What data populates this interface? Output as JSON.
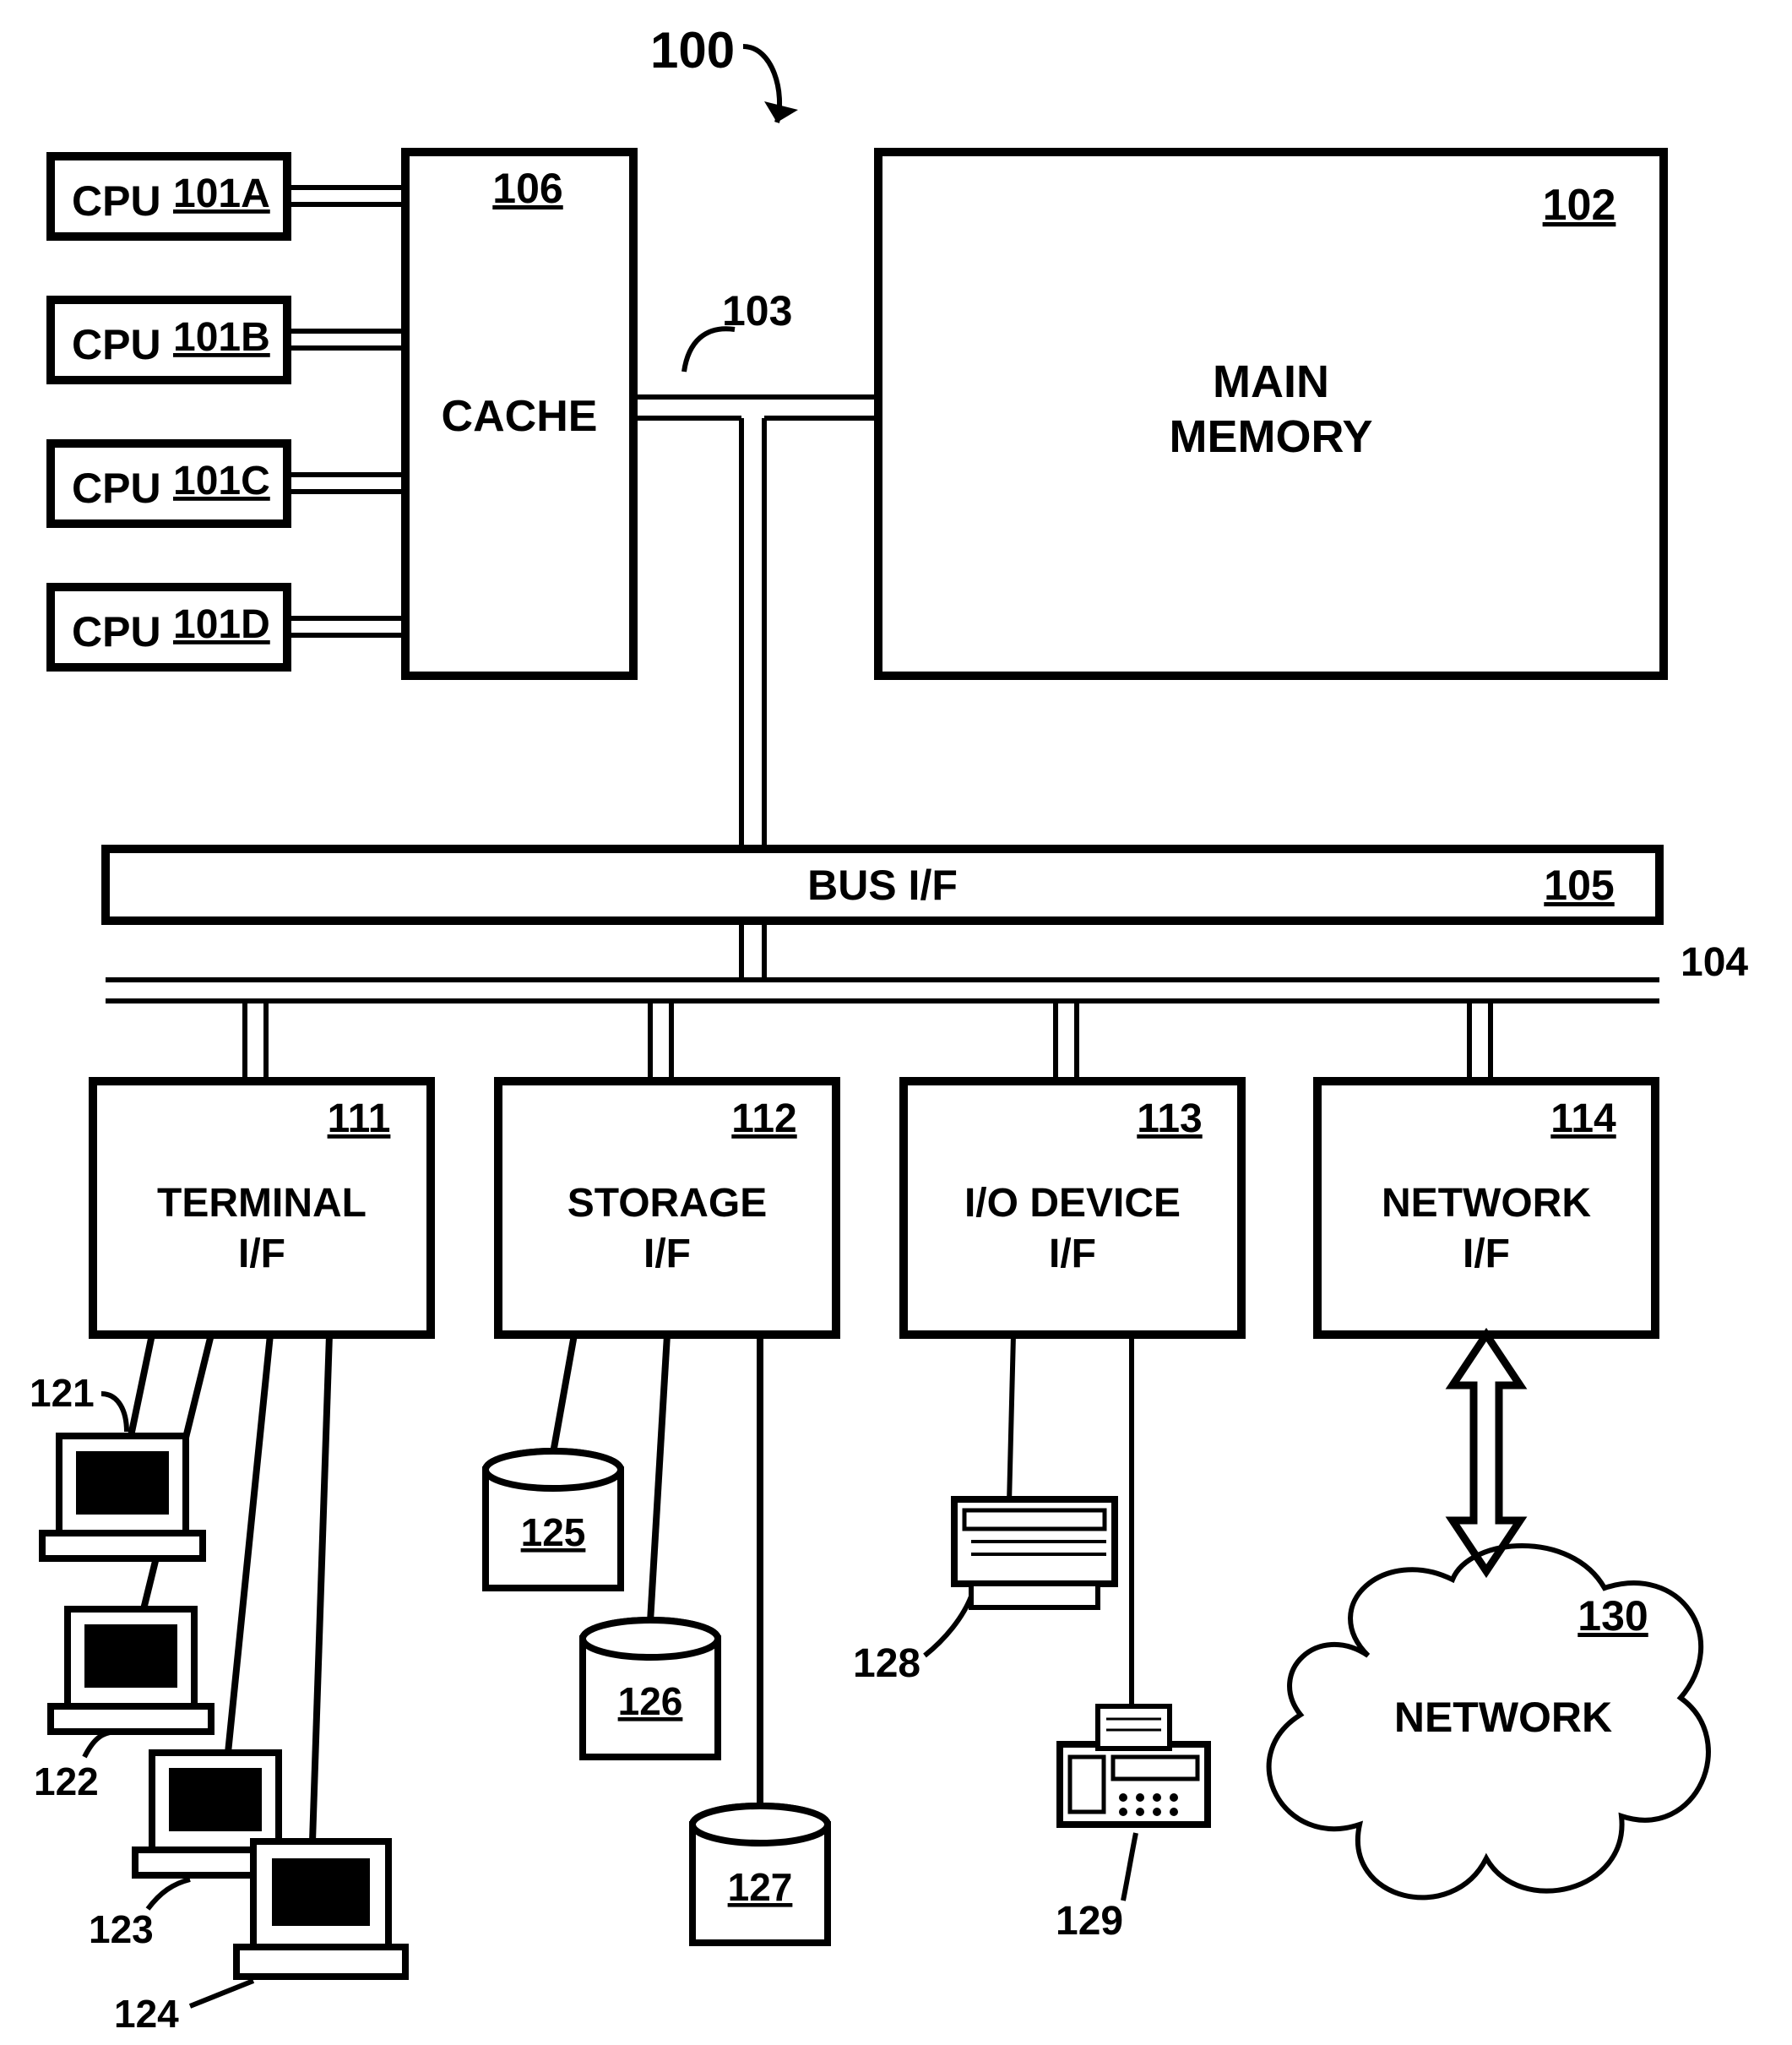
{
  "figure_ref": "100",
  "cpu": {
    "label": "CPU",
    "a": "101A",
    "b": "101B",
    "c": "101C",
    "d": "101D"
  },
  "cache": {
    "label": "CACHE",
    "ref": "106"
  },
  "memory": {
    "line1": "MAIN",
    "line2": "MEMORY",
    "ref": "102"
  },
  "bridge_bus_ref": "103",
  "bus_if": {
    "label": "BUS I/F",
    "ref": "105"
  },
  "io_bus_ref": "104",
  "if": {
    "terminal": {
      "line1": "TERMINAL",
      "line2": "I/F",
      "ref": "111"
    },
    "storage": {
      "line1": "STORAGE",
      "line2": "I/F",
      "ref": "112"
    },
    "iodev": {
      "line1": "I/O DEVICE",
      "line2": "I/F",
      "ref": "113"
    },
    "network": {
      "line1": "NETWORK",
      "line2": "I/F",
      "ref": "114"
    }
  },
  "terminals": {
    "t1": "121",
    "t2": "122",
    "t3": "123",
    "t4": "124"
  },
  "disks": {
    "d1": "125",
    "d2": "126",
    "d3": "127"
  },
  "devices": {
    "printer": "128",
    "fax": "129"
  },
  "network": {
    "label": "NETWORK",
    "ref": "130"
  }
}
